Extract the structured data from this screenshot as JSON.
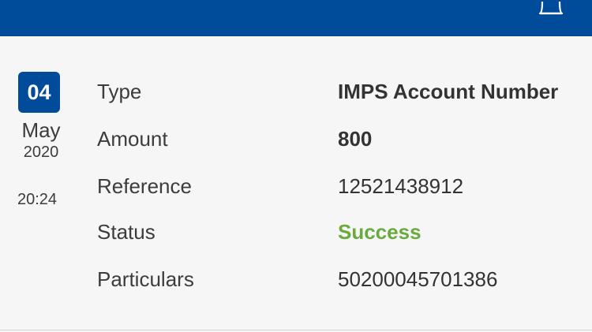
{
  "transaction": {
    "date": {
      "day": "04",
      "month": "May",
      "year": "2020",
      "time": "20:24"
    },
    "fields": {
      "type_label": "Type",
      "type_value": "IMPS Account Number",
      "amount_label": "Amount",
      "amount_value": "800",
      "reference_label": "Reference",
      "reference_value": "12521438912",
      "status_label": "Status",
      "status_value": "Success",
      "particulars_label": "Particulars",
      "particulars_value": "50200045701386"
    }
  },
  "colors": {
    "header_bg": "#004c9a",
    "badge_bg": "#004c9a",
    "success": "#6aaa3f"
  },
  "icons": {
    "header_right": "bell-icon"
  }
}
